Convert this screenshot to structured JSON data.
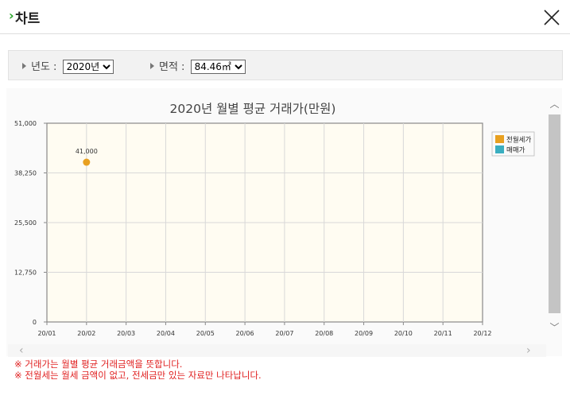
{
  "window": {
    "title": "차트"
  },
  "filters": {
    "year_label": "년도 :",
    "year_value": "2020년",
    "area_label": "면적 :",
    "area_value": "84.46㎡"
  },
  "chart_data": {
    "type": "scatter",
    "title": "2020년 월별 평균 거래가(만원)",
    "categories": [
      "20/01",
      "20/02",
      "20/03",
      "20/04",
      "20/05",
      "20/06",
      "20/07",
      "20/08",
      "20/09",
      "20/10",
      "20/11",
      "20/12"
    ],
    "y_ticks": [
      "0",
      "12,750",
      "25,500",
      "38,250",
      "51,000"
    ],
    "ylim": [
      0,
      51000
    ],
    "grid": true,
    "legend_position": "right",
    "series": [
      {
        "name": "전월세가",
        "color": "#e8a020",
        "points": [
          {
            "x": "20/02",
            "y": 41000,
            "label": "41,000"
          }
        ]
      },
      {
        "name": "매매가",
        "color": "#3aaec0",
        "points": []
      }
    ]
  },
  "notes": [
    "※ 거래가는 월별 평균 거래금액을 뜻합니다.",
    "※ 전월세는 월세 금액이 없고, 전세금만 있는 자료만 나타납니다."
  ]
}
